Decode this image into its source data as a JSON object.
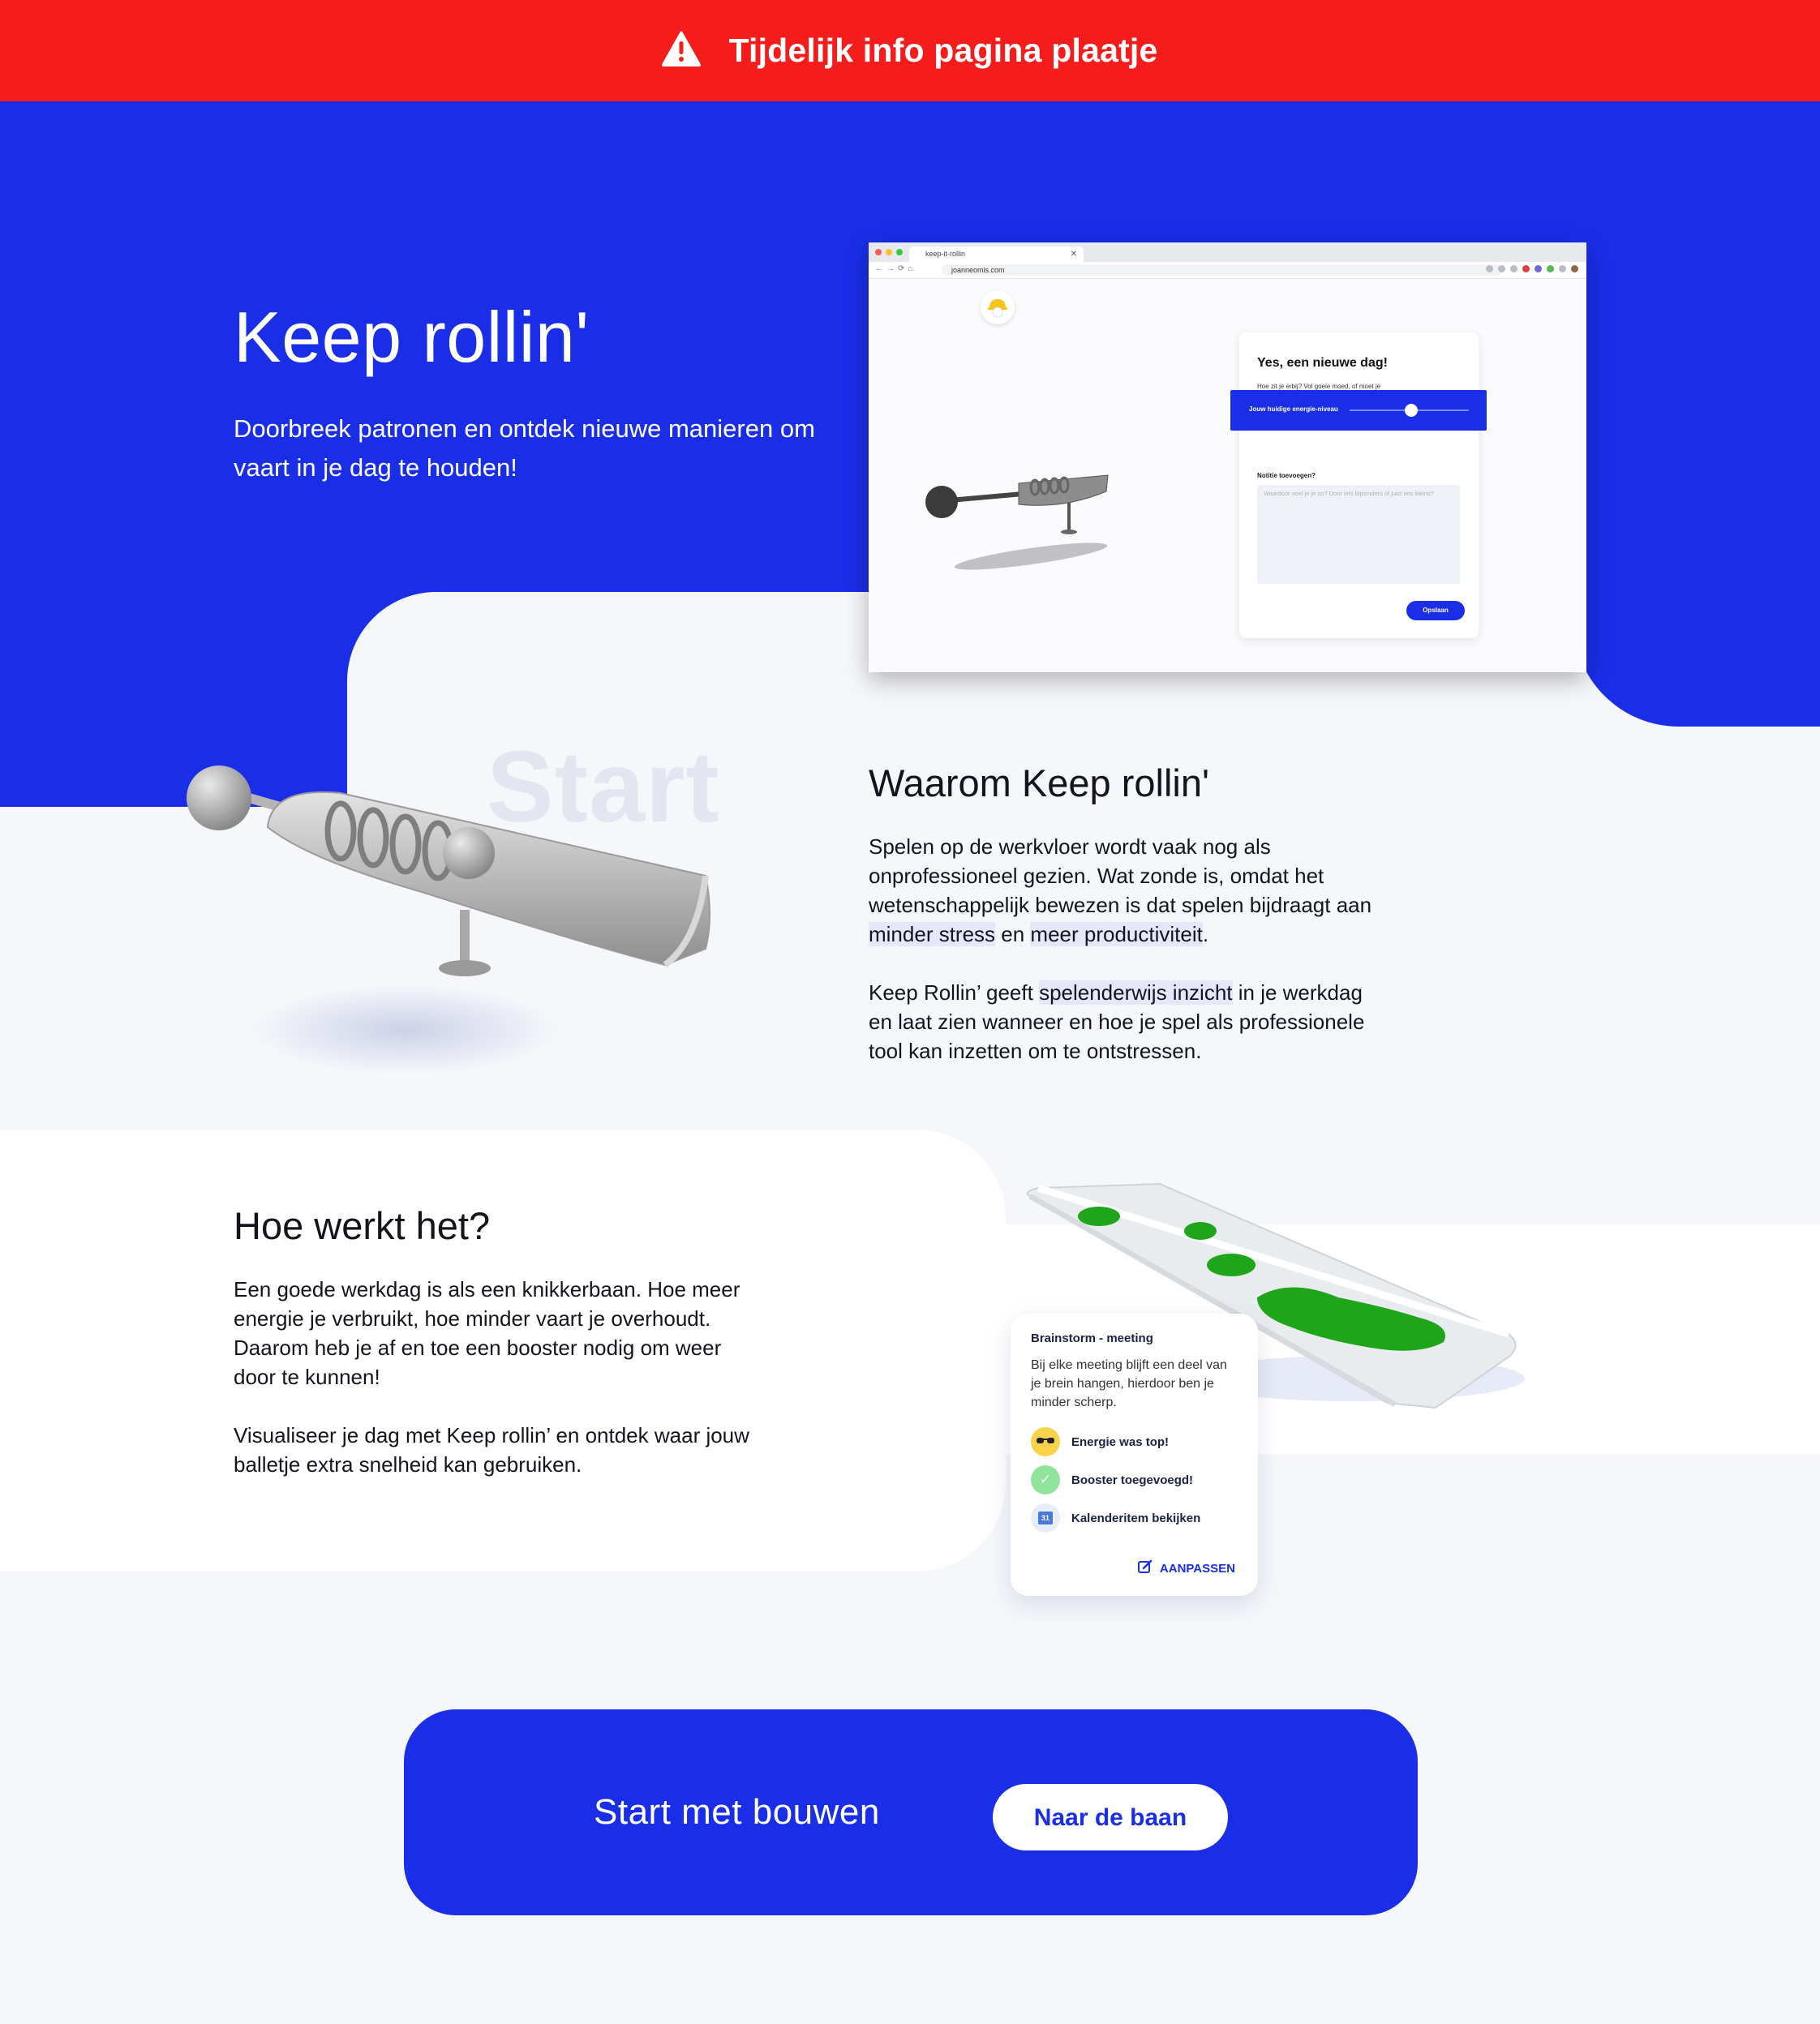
{
  "banner": {
    "text": "Tijdelijk info pagina plaatje",
    "icon": "warning-icon"
  },
  "hero": {
    "title": "Keep rollin'",
    "subtitle": "Doorbreek patronen en ontdek nieuwe manieren om vaart in je dag te houden!"
  },
  "browser": {
    "tab_title": "keep-it-rollin",
    "url": "joanneomis.com",
    "card_title": "Yes, een nieuwe dag!",
    "card_question": "Hoe zit je erbij? Vol goeie moed, of moet je nog even op gang komen?",
    "energy_label": "Jouw huidige energie-niveau",
    "note_label": "Notitie toevoegen?",
    "note_placeholder": "Waardoor voel je je zo? Door iets bijzonders of juist iets kleins?",
    "save_button": "Opslaan"
  },
  "watermark": {
    "text": "Start"
  },
  "waarom": {
    "title": "Waarom Keep rollin'",
    "p1_before": "Spelen op de werkvloer wordt vaak nog als onprofessioneel gezien. Wat zonde is, omdat het wetenschappelijk bewezen is dat spelen bijdraagt aan ",
    "p1_hl1": "minder stress",
    "p1_mid": " en ",
    "p1_hl2": "meer productiviteit",
    "p1_after": ".",
    "p2_before": "Keep Rollin’ geeft ",
    "p2_hl": "spelenderwijs inzicht",
    "p2_after": " in je werkdag en laat zien wanneer en hoe je spel als professionele tool kan inzetten om te ontstressen."
  },
  "hoe": {
    "title": "Hoe werkt het?",
    "p1": "Een goede werkdag is als een knikkerbaan. Hoe meer energie je verbruikt, hoe minder vaart je overhoudt. Daarom heb je af en toe een booster nodig om weer door te kunnen!",
    "p2": "Visualiseer je dag met Keep rollin’ en ontdek waar jouw balletje extra snelheid kan gebruiken."
  },
  "meeting": {
    "title": "Brainstorm - meeting",
    "description": "Bij elke meeting blijft een deel van je brein hangen, hierdoor ben  je minder scherp.",
    "rows": [
      {
        "label": "Energie was top!",
        "icon": "sunglasses-emoji-icon"
      },
      {
        "label": "Booster toegevoegd!",
        "icon": "check-icon"
      },
      {
        "label": "Kalenderitem bekijken",
        "icon": "calendar-icon",
        "icon_text": "31"
      }
    ],
    "edit_label": "AANPASSEN"
  },
  "cta": {
    "text": "Start met bouwen",
    "button": "Naar de baan"
  },
  "colors": {
    "brand_blue": "#1a2ee8",
    "banner_red": "#f51c1c",
    "background": "#f5f7fb",
    "slime_green": "#1fa51a"
  }
}
